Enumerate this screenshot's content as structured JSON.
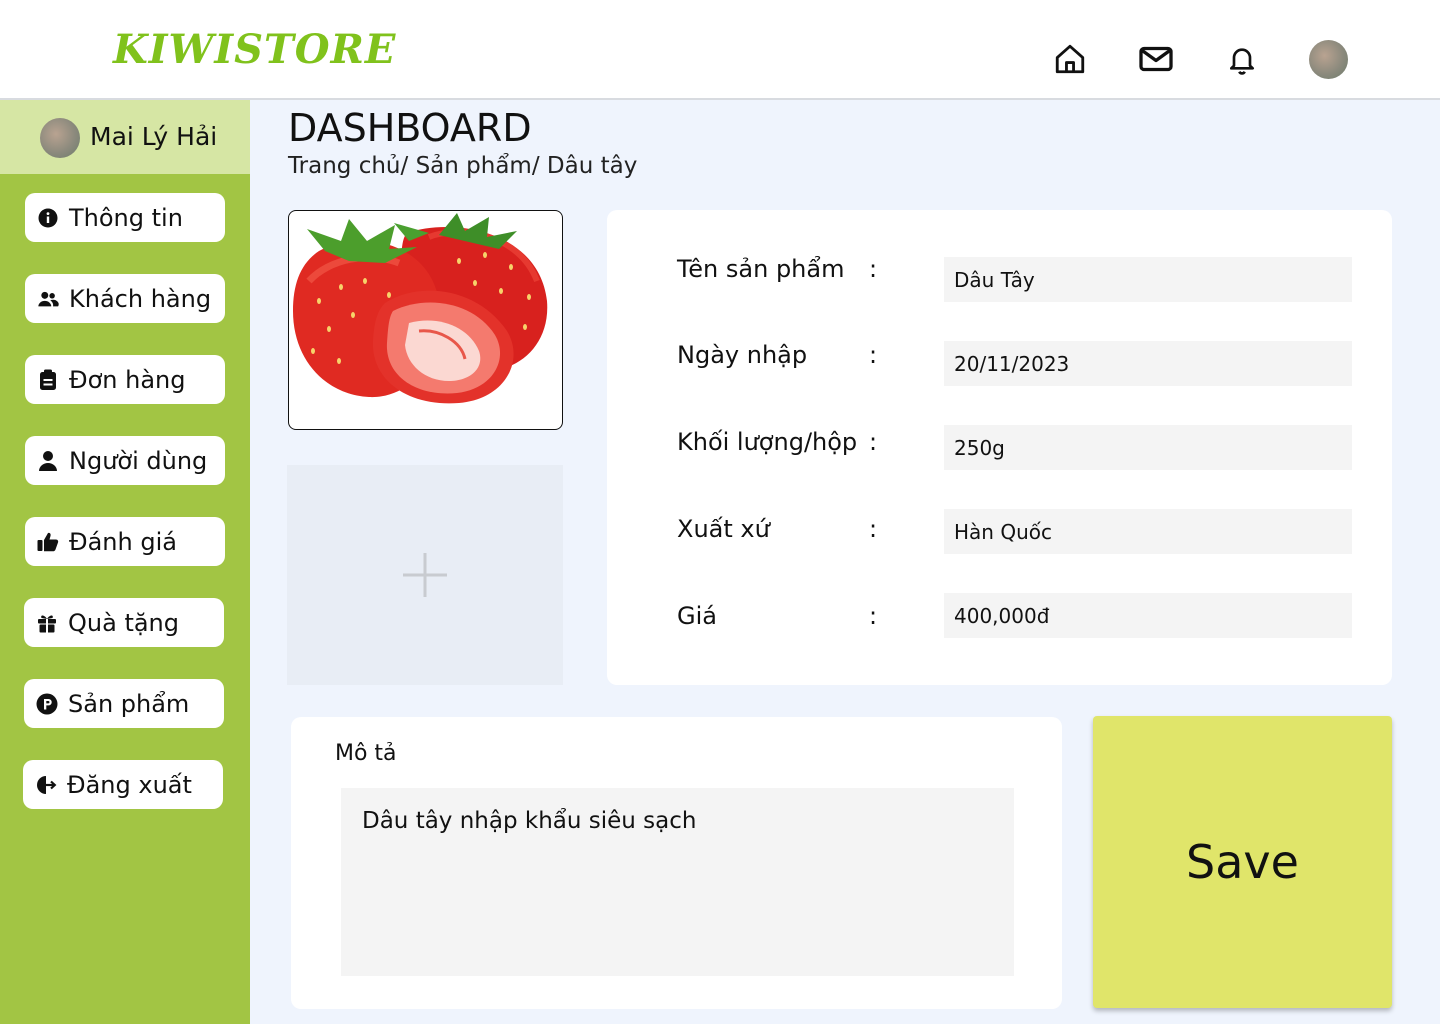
{
  "header": {
    "logo": "KIWISTORE",
    "icons": [
      "home-icon",
      "mail-icon",
      "bell-icon",
      "avatar"
    ]
  },
  "sidebar": {
    "user_name": "Mai Lý Hải",
    "items": [
      {
        "label": "Thông tin",
        "icon": "info-icon"
      },
      {
        "label": "Khách hàng",
        "icon": "users-icon"
      },
      {
        "label": "Đơn hàng",
        "icon": "order-icon"
      },
      {
        "label": "Người dùng",
        "icon": "user-icon"
      },
      {
        "label": "Đánh giá",
        "icon": "thumbs-up-icon"
      },
      {
        "label": "Quà tặng",
        "icon": "gift-icon"
      },
      {
        "label": "Sản phẩm",
        "icon": "product-icon"
      },
      {
        "label": "Đăng xuất",
        "icon": "logout-icon"
      }
    ]
  },
  "main": {
    "title": "DASHBOARD",
    "breadcrumb": "Trang chủ/ Sản phẩm/ Dâu tây",
    "form": {
      "fields": [
        {
          "label": "Tên sản phẩm",
          "value": "Dâu Tây"
        },
        {
          "label": "Ngày nhập",
          "value": "20/11/2023"
        },
        {
          "label": "Khối lượng/hộp",
          "value": "250g"
        },
        {
          "label": "Xuất xứ",
          "value": "Hàn Quốc"
        },
        {
          "label": "Giá",
          "value": "400,000đ"
        }
      ],
      "colon": ":"
    },
    "description": {
      "label": "Mô tả",
      "value": "Dâu tây nhập khẩu siêu sạch"
    },
    "save_label": "Save"
  },
  "colors": {
    "brand": "#80c21c",
    "sidebar": "#a2c544",
    "sidebar_user": "#d6e6a4",
    "save": "#e0e56a",
    "background": "#eff4fd"
  }
}
